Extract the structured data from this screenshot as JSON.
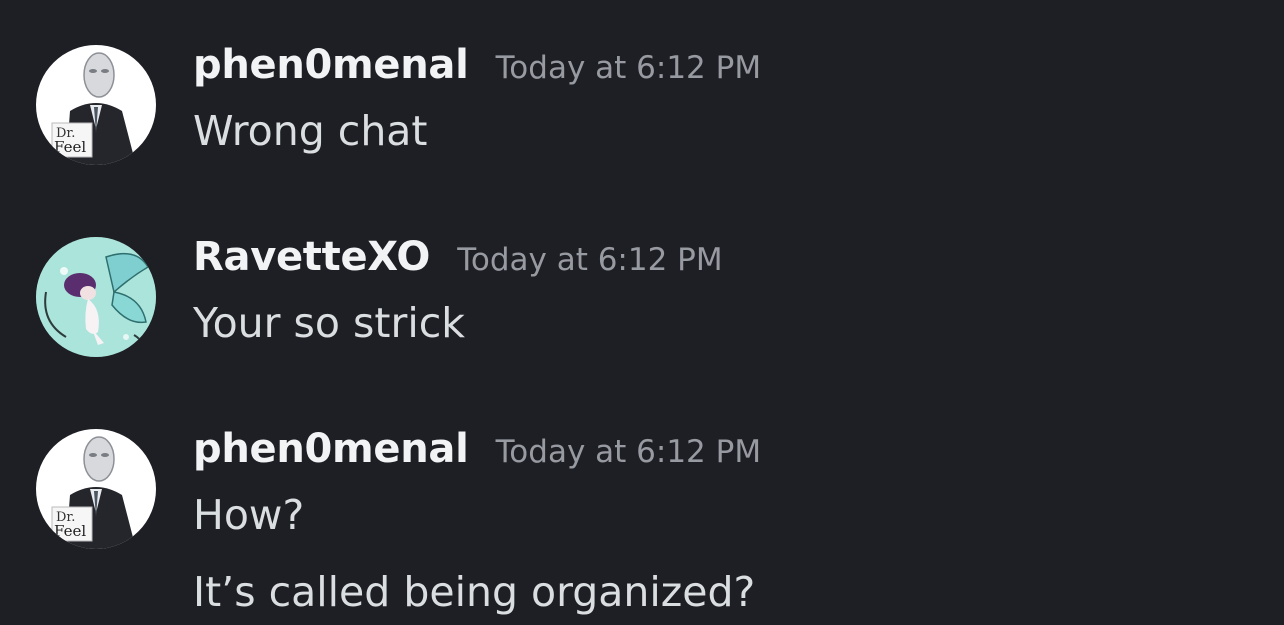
{
  "colors": {
    "background": "#1e1f24",
    "username": "#f2f3f5",
    "timestamp": "#989aa2",
    "message_text": "#dbdee1"
  },
  "messages": [
    {
      "username": "phen0menal",
      "timestamp": "Today at 6:12 PM",
      "avatar": "dr-feel-avatar",
      "avatar_text": [
        "Dr.",
        "Feel"
      ],
      "lines": [
        "Wrong chat"
      ]
    },
    {
      "username": "RavetteXO",
      "timestamp": "Today at 6:12 PM",
      "avatar": "fairy-avatar",
      "lines": [
        "Your so strick"
      ]
    },
    {
      "username": "phen0menal",
      "timestamp": "Today at 6:12 PM",
      "avatar": "dr-feel-avatar",
      "avatar_text": [
        "Dr.",
        "Feel"
      ],
      "lines": [
        "How?",
        "It’s called being organized?"
      ]
    }
  ]
}
